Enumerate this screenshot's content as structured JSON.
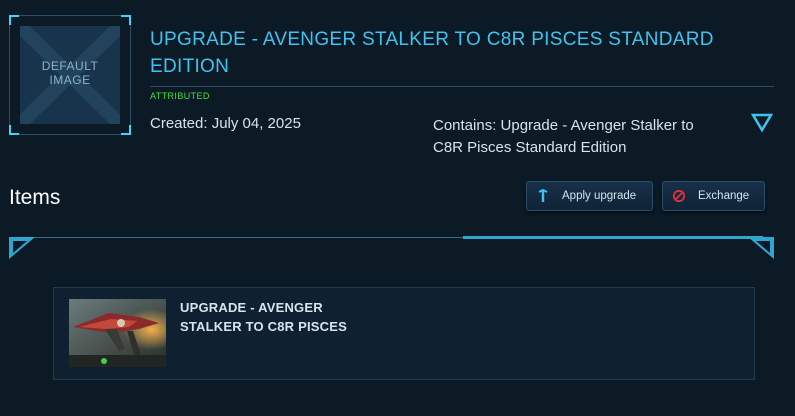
{
  "thumbnail": {
    "line1": "DEFAULT",
    "line2": "IMAGE"
  },
  "product": {
    "title": "UPGRADE - AVENGER STALKER TO C8R PISCES STANDARD EDITION",
    "badge": "ATTRIBUTED",
    "created": "Created: July 04, 2025",
    "contains": "Contains: Upgrade - Avenger Stalker to C8R Pisces Standard Edition"
  },
  "items_section": {
    "heading": "Items",
    "apply_label": "Apply upgrade",
    "exchange_label": "Exchange"
  },
  "items": [
    {
      "title": "UPGRADE - AVENGER STALKER TO C8R PISCES"
    }
  ],
  "colors": {
    "accent": "#3fc3f0",
    "badge_green": "#3fe23a",
    "exchange_red": "#e0303a",
    "background": "#0c1a26"
  },
  "icons": {
    "toggle": "chevron-down-icon",
    "apply": "upgrade-arrow-icon",
    "exchange": "prohibit-icon"
  }
}
